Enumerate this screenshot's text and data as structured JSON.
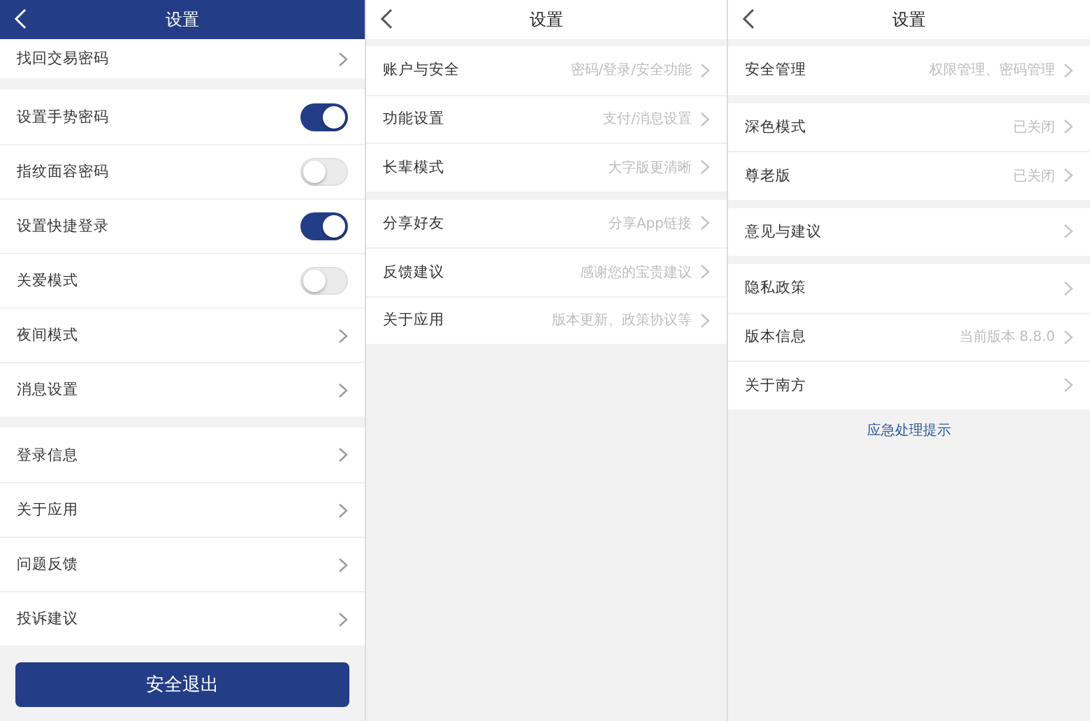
{
  "panels": [
    {
      "kind": "filled",
      "title": "设置",
      "groups": [
        [
          {
            "label": "找回交易密码",
            "kind": "link"
          }
        ],
        [
          {
            "label": "设置手势密码",
            "kind": "toggle",
            "on": true
          },
          {
            "label": "指纹面容密码",
            "kind": "toggle",
            "on": false
          },
          {
            "label": "设置快捷登录",
            "kind": "toggle",
            "on": true
          },
          {
            "label": "关爱模式",
            "kind": "toggle",
            "on": false
          },
          {
            "label": "夜间模式",
            "kind": "link"
          },
          {
            "label": "消息设置",
            "kind": "link"
          }
        ],
        [
          {
            "label": "登录信息",
            "kind": "link"
          },
          {
            "label": "关于应用",
            "kind": "link"
          },
          {
            "label": "问题反馈",
            "kind": "link"
          },
          {
            "label": "投诉建议",
            "kind": "link"
          }
        ]
      ],
      "footer": {
        "kind": "button",
        "label": "安全退出"
      }
    },
    {
      "kind": "plain",
      "title": "设置",
      "groups": [
        [
          {
            "label": "账户与安全",
            "kind": "link",
            "value": "密码/登录/安全功能"
          },
          {
            "label": "功能设置",
            "kind": "link",
            "value": "支付/消息设置"
          },
          {
            "label": "长辈模式",
            "kind": "link",
            "value": "大字版更清晰"
          }
        ],
        [
          {
            "label": "分享好友",
            "kind": "link",
            "value": "分享App链接"
          },
          {
            "label": "反馈建议",
            "kind": "link",
            "value": "感谢您的宝贵建议"
          },
          {
            "label": "关于应用",
            "kind": "link",
            "value": "版本更新、政策协议等"
          }
        ]
      ]
    },
    {
      "kind": "plain",
      "title": "设置",
      "groups": [
        [
          {
            "label": "安全管理",
            "kind": "link",
            "value": "权限管理、密码管理"
          }
        ],
        [
          {
            "label": "深色模式",
            "kind": "link",
            "value": "已关闭"
          },
          {
            "label": "尊老版",
            "kind": "link",
            "value": "已关闭"
          }
        ],
        [
          {
            "label": "意见与建议",
            "kind": "link"
          }
        ],
        [
          {
            "label": "隐私政策",
            "kind": "link"
          },
          {
            "label": "版本信息",
            "kind": "link",
            "value": "当前版本 8.8.0"
          },
          {
            "label": "关于南方",
            "kind": "link"
          }
        ]
      ],
      "footer": {
        "kind": "link",
        "label": "应急处理提示"
      }
    }
  ]
}
